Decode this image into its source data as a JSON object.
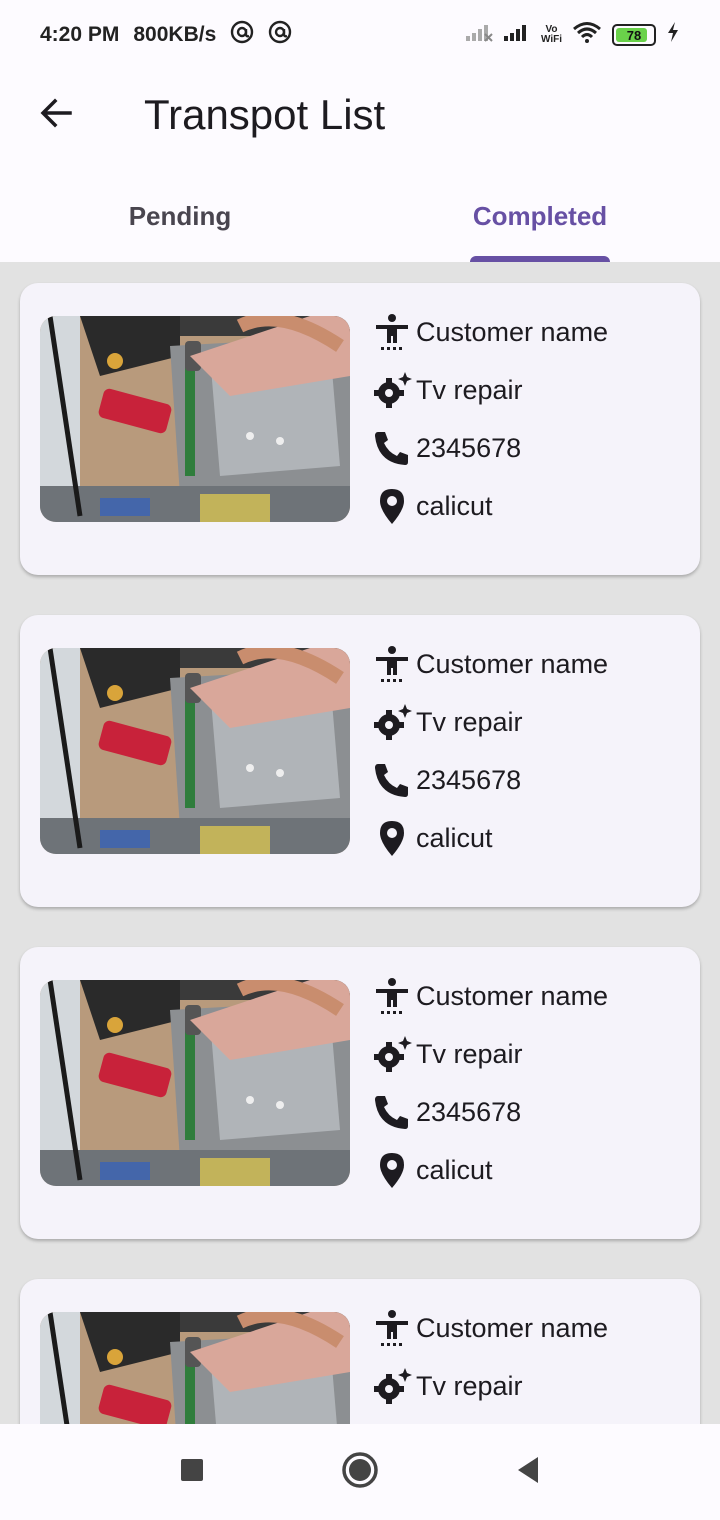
{
  "status_bar": {
    "time": "4:20 PM",
    "speed": "800KB/s",
    "battery": "78",
    "vowifi_top": "Vo",
    "vowifi_bottom": "WiFi",
    "icons": [
      "at-sign-icon",
      "at-sign-icon",
      "signal-off-icon",
      "signal-icon",
      "vowifi-icon",
      "wifi-icon",
      "battery-icon",
      "charging-icon"
    ]
  },
  "app_bar": {
    "title": "Transpot List",
    "back_icon": "arrow-back-icon"
  },
  "tabs": [
    {
      "label": "Pending",
      "active": false
    },
    {
      "label": "Completed",
      "active": true
    }
  ],
  "cards": [
    {
      "name": "Customer name",
      "service": "Tv repair",
      "phone": "2345678",
      "location": "calicut"
    },
    {
      "name": "Customer name",
      "service": "Tv repair",
      "phone": "2345678",
      "location": "calicut"
    },
    {
      "name": "Customer name",
      "service": "Tv repair",
      "phone": "2345678",
      "location": "calicut"
    },
    {
      "name": "Customer name",
      "service": "Tv repair",
      "phone": "",
      "location": ""
    }
  ],
  "nav": {
    "icons": [
      "recents-square-icon",
      "home-circle-icon",
      "back-triangle-icon"
    ]
  },
  "colors": {
    "accent": "#6750a4",
    "list_background": "#e2e2e2",
    "card_background": "#f5f3fa"
  }
}
